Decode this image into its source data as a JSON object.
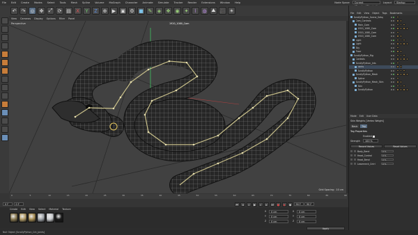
{
  "menubar": {
    "items": [
      "File",
      "Edit",
      "Create",
      "Modes",
      "Select",
      "Tools",
      "Mesh",
      "Spline",
      "Volume",
      "MoGraph",
      "Character",
      "Animate",
      "Simulate",
      "Tracker",
      "Render",
      "Extensions",
      "Window",
      "Help"
    ],
    "node_space_label": "Node Space",
    "node_space_value": "Current (Standard/Physical)",
    "layout_label": "Layout",
    "layout_value": "Startup"
  },
  "viewport": {
    "menu": [
      "View",
      "Cameras",
      "Display",
      "Options",
      "Filter",
      "Panel"
    ],
    "name": "Perspective",
    "camera": "1920_1080_Cam",
    "grid_spacing": "Grid Spacing : 10 cm"
  },
  "object_manager": {
    "menu": [
      "File",
      "Edit",
      "View",
      "Object",
      "Tags",
      "Bookmarks"
    ],
    "rows": [
      {
        "name": "ScrollyPython_Scene_Setup",
        "depth": 0
      },
      {
        "name": "Cam_Controls",
        "depth": 1
      },
      {
        "name": "Main_Cam",
        "depth": 2
      },
      {
        "name": "1920_1080_Cam",
        "depth": 2
      },
      {
        "name": "1920_1080_Cam",
        "depth": 2
      },
      {
        "name": "1920_1080_Cam",
        "depth": 2
      },
      {
        "name": "Light",
        "depth": 1
      },
      {
        "name": "Light",
        "depth": 1
      },
      {
        "name": "Sky",
        "depth": 1
      },
      {
        "name": "Floor",
        "depth": 1
      },
      {
        "name": "ScrollyPython_Rig",
        "depth": 0
      },
      {
        "name": "Controls",
        "depth": 1
      },
      {
        "name": "ScrollyPython_Jnts",
        "depth": 1
      },
      {
        "name": "Joints",
        "depth": 2
      },
      {
        "name": "ScrollyPython",
        "depth": 2
      },
      {
        "name": "ScrollyPython_Mesh",
        "depth": 1
      },
      {
        "name": "Spline",
        "depth": 2
      },
      {
        "name": "ScrollyPython_Mesh_Skin",
        "depth": 1
      },
      {
        "name": "Skin",
        "depth": 2
      },
      {
        "name": "ScrollyPython",
        "depth": 2
      }
    ]
  },
  "attribute_manager": {
    "menu": [
      "Mode",
      "Edit",
      "User Data"
    ],
    "object_label": "Skin Weights [Vertex Weight]",
    "tabs": [
      "Basic",
      "Tag"
    ],
    "section_title": "Tag Properties",
    "enabled_label": "Enabled",
    "strength_label": "Strength",
    "strength_value": "100 %",
    "buttons": [
      "Record Values",
      "Reset Values"
    ],
    "joints": [
      {
        "name": "Body_Bend",
        "value": "0 %"
      },
      {
        "name": "Head_Control",
        "value": "0 %"
      },
      {
        "name": "Head_Bend",
        "value": "0 %"
      },
      {
        "name": "Lowerneck_Cntrl",
        "value": "0 %"
      }
    ]
  },
  "timeline": {
    "ticks": [
      "0",
      "5",
      "10",
      "15",
      "20",
      "25",
      "30",
      "35",
      "40",
      "45",
      "50",
      "55",
      "60",
      "65",
      "70",
      "75",
      "80",
      "85",
      "90"
    ],
    "current_frame": "0 F",
    "end_frame": "90 F"
  },
  "material_manager": {
    "menu": [
      "Create",
      "Edit",
      "View",
      "Select",
      "Material",
      "Texture"
    ],
    "swatches": [
      "#8a7a52",
      "#b19b68",
      "#a68d55",
      "#9fa3a8",
      "#c7c9cc",
      "#1b1b1b"
    ]
  },
  "coordinates": {
    "rows": [
      {
        "axis": "X",
        "pos": "0 cm",
        "size": "0 cm"
      },
      {
        "axis": "Y",
        "pos": "0 cm",
        "size": "0 cm"
      },
      {
        "axis": "Z",
        "pos": "0 cm",
        "size": "0 cm"
      }
    ],
    "apply_label": "Apply"
  },
  "status": {
    "text": "Null Object [ScrollyPython_Cnt_Joints]"
  }
}
